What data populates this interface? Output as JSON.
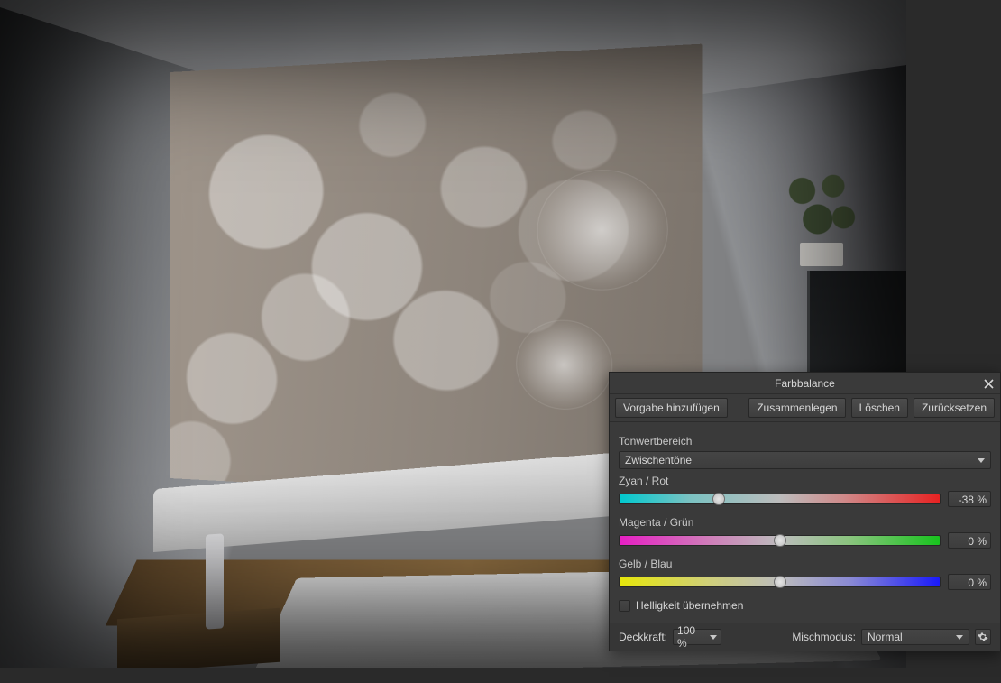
{
  "dialog": {
    "title": "Farbbalance",
    "buttons": {
      "add_preset": "Vorgabe hinzufügen",
      "merge": "Zusammenlegen",
      "delete": "Löschen",
      "reset": "Zurücksetzen"
    },
    "tone_section_label": "Tonwertbereich",
    "tone_value": "Zwischentöne",
    "sliders": {
      "cyan_red": {
        "label": "Zyan / Rot",
        "value": "-38 %",
        "pos_pct": 31
      },
      "mag_green": {
        "label": "Magenta / Grün",
        "value": "0 %",
        "pos_pct": 50
      },
      "yellow_blue": {
        "label": "Gelb / Blau",
        "value": "0 %",
        "pos_pct": 50
      }
    },
    "preserve_luminosity_label": "Helligkeit übernehmen",
    "preserve_luminosity_checked": false,
    "footer": {
      "opacity_label": "Deckkraft:",
      "opacity_value": "100 %",
      "blendmode_label": "Mischmodus:",
      "blendmode_value": "Normal"
    }
  }
}
